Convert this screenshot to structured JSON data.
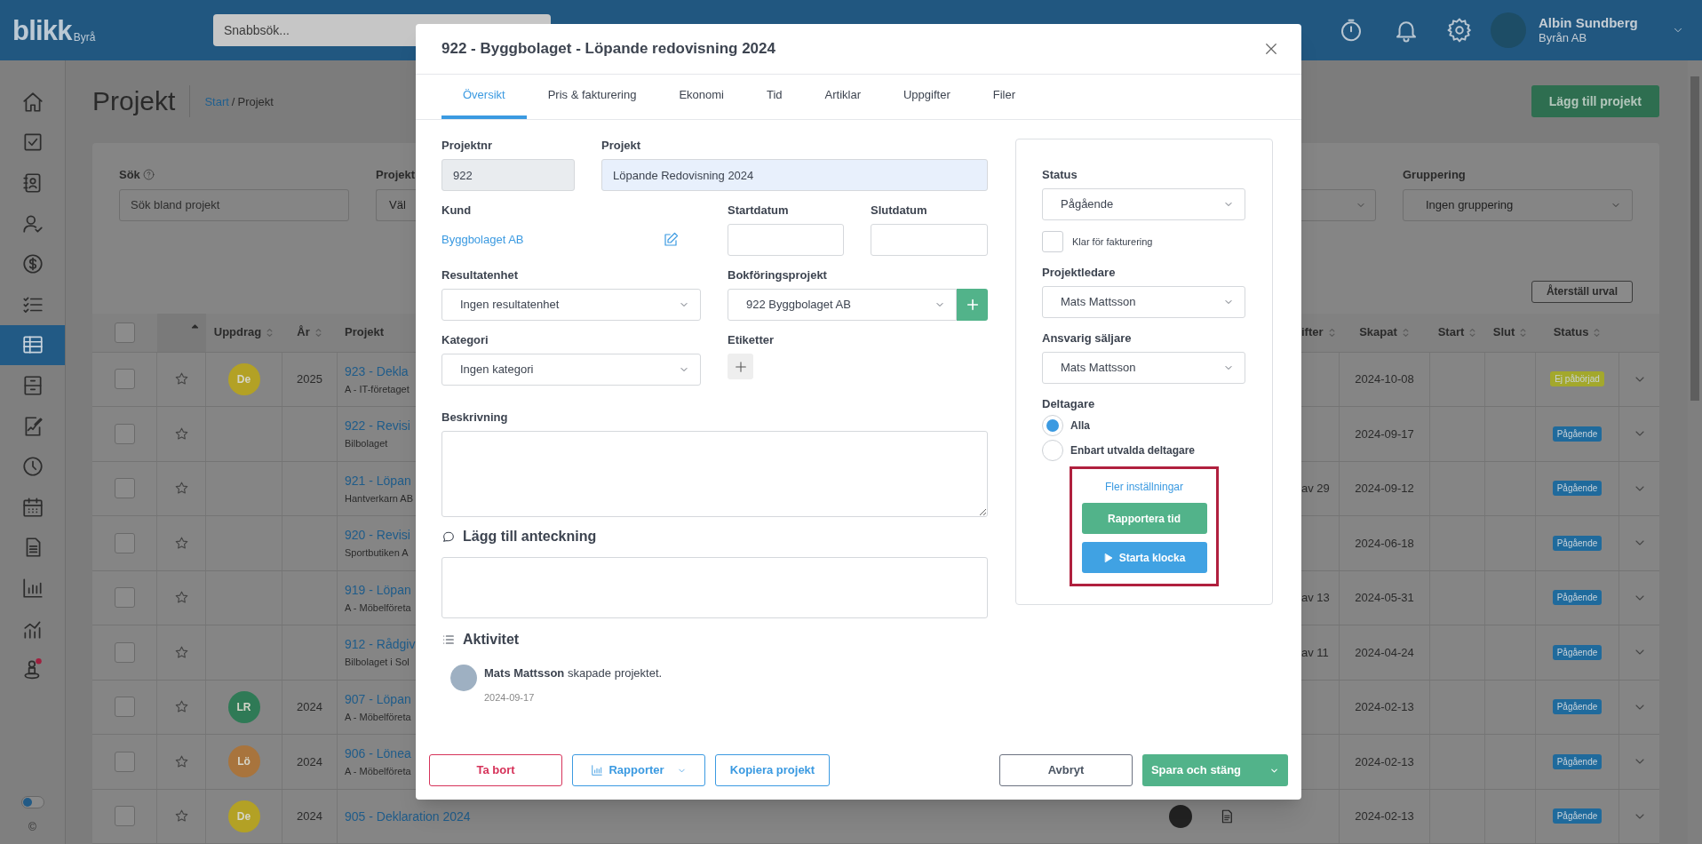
{
  "app": {
    "logo": "blikk",
    "logo_suffix": "Byrå",
    "search_placeholder": "Snabbsök...",
    "user": {
      "name": "Albin Sundberg",
      "company": "Byrån AB"
    }
  },
  "sidebar": {
    "items": [
      {
        "selected": false
      },
      {
        "selected": false
      },
      {
        "selected": false
      },
      {
        "selected": false
      },
      {
        "selected": false
      },
      {
        "selected": false
      },
      {
        "selected": true
      },
      {
        "selected": false
      },
      {
        "selected": false
      },
      {
        "selected": false
      },
      {
        "selected": false
      },
      {
        "selected": false
      },
      {
        "selected": false
      },
      {
        "selected": false
      },
      {
        "selected": false
      }
    ],
    "dark_mode_toggle": {
      "on": false
    },
    "copyright": "©"
  },
  "page": {
    "title": "Projekt",
    "breadcrumb": {
      "link": "Start",
      "separator": "/",
      "current": "Projekt"
    },
    "add_button": "Lägg till projekt"
  },
  "filters": {
    "search": {
      "label": "Sök",
      "placeholder": "Sök bland projekt"
    },
    "project_filter": {
      "label": "Projekt",
      "value": "Väl"
    },
    "grouping": {
      "label": "Gruppering",
      "value": "Ingen gruppering"
    },
    "reset_button": "Återställ urval"
  },
  "table": {
    "select_all_checked": false,
    "columns_left": [
      {
        "label": "Uppdrag",
        "sortable": true
      },
      {
        "label": "År",
        "sortable": true
      },
      {
        "label": "Projekt",
        "sortable": false
      }
    ],
    "columns_right": [
      {
        "label": "ifter",
        "sortable": true
      },
      {
        "label": "Skapat",
        "sortable": true
      },
      {
        "label": "Start",
        "sortable": true
      },
      {
        "label": "Slut",
        "sortable": true
      },
      {
        "label": "Status",
        "sortable": true
      }
    ],
    "rows": [
      {
        "checked": false,
        "starred": false,
        "badge": {
          "text": "De",
          "color": "#b3a125"
        },
        "year": "2025",
        "project": "923 - Dekla",
        "customer": "A - IT-företaget",
        "column_4": "",
        "created": "2024-10-08",
        "status": {
          "text": "Ej påbörjad",
          "color": "#a3a82c"
        }
      },
      {
        "checked": false,
        "starred": false,
        "year": "",
        "project": "922 - Revisi",
        "customer": "Bilbolaget",
        "column_4": "",
        "created": "2024-09-17",
        "status": {
          "text": "Pågående",
          "color": "#1f6a9c"
        }
      },
      {
        "checked": false,
        "starred": false,
        "year": "",
        "project": "921 - Löpan",
        "customer": "Hantverkarn AB",
        "column_4": "av 29",
        "created": "2024-09-12",
        "status": {
          "text": "Pågående",
          "color": "#1f6a9c"
        }
      },
      {
        "checked": false,
        "starred": false,
        "year": "",
        "project": "920 - Revisi",
        "customer": "Sportbutiken A",
        "column_4": "",
        "created": "2024-06-18",
        "status": {
          "text": "Pågående",
          "color": "#1f6a9c"
        }
      },
      {
        "checked": false,
        "starred": false,
        "year": "",
        "project": "919 - Löpan",
        "customer": "A - Möbelföreta",
        "column_4": "av 13",
        "created": "2024-05-31",
        "status": {
          "text": "Pågående",
          "color": "#1f6a9c"
        }
      },
      {
        "checked": false,
        "starred": false,
        "year": "",
        "project": "912 - Rådgiv",
        "customer": "Bilbolaget i Sol",
        "column_4": "av 11",
        "created": "2024-04-24",
        "status": {
          "text": "Pågående",
          "color": "#1f6a9c"
        }
      },
      {
        "checked": false,
        "starred": false,
        "badge": {
          "text": "LR",
          "color": "#2f7a56"
        },
        "year": "2024",
        "project": "907 - Löpan",
        "customer": "A - Möbelföreta",
        "column_4": "",
        "created": "2024-02-13",
        "status": {
          "text": "Pågående",
          "color": "#1f6a9c"
        }
      },
      {
        "checked": false,
        "starred": false,
        "badge": {
          "text": "Lö",
          "color": "#a8743d"
        },
        "year": "2024",
        "project": "906 - Lönea",
        "customer": "A - Möbelföreta",
        "column_4": "",
        "created": "2024-02-13",
        "status": {
          "text": "Pågående",
          "color": "#1f6a9c"
        }
      },
      {
        "checked": false,
        "starred": false,
        "badge": {
          "text": "De",
          "color": "#b3a125"
        },
        "year": "2024",
        "project": "905 - Deklaration 2024",
        "customer": "",
        "column_4": "",
        "created": "2024-02-13",
        "status": {
          "text": "Pågående",
          "color": "#1f6a9c"
        },
        "assignee_avatar": true,
        "document": true
      }
    ]
  },
  "modal": {
    "title": "922 - Byggbolaget - Löpande redovisning 2024",
    "tabs": [
      {
        "label": "Översikt",
        "selected": true
      },
      {
        "label": "Pris & fakturering",
        "selected": false
      },
      {
        "label": "Ekonomi",
        "selected": false
      },
      {
        "label": "Tid",
        "selected": false
      },
      {
        "label": "Artiklar",
        "selected": false
      },
      {
        "label": "Uppgifter",
        "selected": false
      },
      {
        "label": "Filer",
        "selected": false
      }
    ],
    "project_number": {
      "label": "Projektnr",
      "value": "922",
      "disabled": true
    },
    "project_name": {
      "label": "Projekt",
      "value": "Löpande Redovisning 2024"
    },
    "customer": {
      "label": "Kund",
      "value": "Byggbolaget AB"
    },
    "start_date": {
      "label": "Startdatum"
    },
    "end_date": {
      "label": "Slutdatum"
    },
    "result_unit": {
      "label": "Resultatenhet",
      "value": "Ingen resultatenhet"
    },
    "booking_project": {
      "label": "Bokföringsprojekt",
      "value": "922 Byggbolaget AB"
    },
    "category": {
      "label": "Kategori",
      "value": "Ingen kategori"
    },
    "tags": {
      "label": "Etiketter"
    },
    "description": {
      "label": "Beskrivning"
    },
    "note": {
      "label": "Lägg till anteckning"
    },
    "activity": {
      "title": "Aktivitet",
      "entries": [
        {
          "user": "Mats Mattsson",
          "text": "skapade projektet.",
          "date": "2024-09-17"
        }
      ]
    },
    "side_panel": {
      "status": {
        "label": "Status",
        "value": "Pågående"
      },
      "ready_for_invoicing": {
        "label": "Klar för fakturering",
        "checked": false
      },
      "project_manager": {
        "label": "Projektledare",
        "value": "Mats Mattsson"
      },
      "salesperson": {
        "label": "Ansvarig säljare",
        "value": "Mats Mattsson"
      },
      "participants": {
        "label": "Deltagare",
        "options": [
          {
            "label": "Alla",
            "selected": true
          },
          {
            "label": "Enbart utvalda deltagare",
            "selected": false
          }
        ]
      },
      "more_settings": "Fler inställningar",
      "report_time": "Rapportera tid",
      "start_clock": "Starta klocka"
    },
    "footer_left": [
      {
        "label": "Ta bort",
        "kind": "danger"
      },
      {
        "label": "Rapporter",
        "kind": "menu"
      },
      {
        "label": "Kopiera projekt",
        "kind": "outline"
      }
    ],
    "footer_right": [
      {
        "label": "Avbryt",
        "kind": "neutral"
      },
      {
        "label": "Spara och stäng",
        "kind": "split"
      }
    ]
  }
}
